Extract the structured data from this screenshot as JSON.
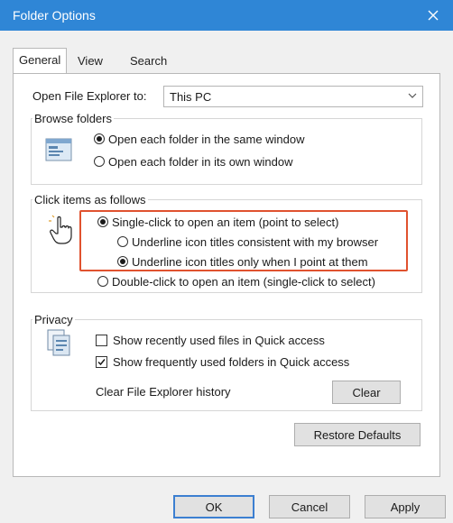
{
  "window": {
    "title": "Folder Options",
    "close_icon": "close-icon"
  },
  "tabs": [
    {
      "label": "General",
      "active": true
    },
    {
      "label": "View",
      "active": false
    },
    {
      "label": "Search",
      "active": false
    }
  ],
  "general": {
    "open_to_label": "Open File Explorer to:",
    "open_to_value": "This PC",
    "browse": {
      "title": "Browse folders",
      "icon": "browse-folders-icon",
      "options": [
        {
          "label": "Open each folder in the same window",
          "checked": true
        },
        {
          "label": "Open each folder in its own window",
          "checked": false
        }
      ]
    },
    "click": {
      "title": "Click items as follows",
      "icon": "hand-pointer-icon",
      "single_click": {
        "label": "Single-click to open an item (point to select)",
        "checked": true
      },
      "underline_always": {
        "label": "Underline icon titles consistent with my browser",
        "checked": false
      },
      "underline_point": {
        "label": "Underline icon titles only when I point at them",
        "checked": true
      },
      "double_click": {
        "label": "Double-click to open an item (single-click to select)",
        "checked": false
      },
      "highlight_color": "#e0522f"
    },
    "privacy": {
      "title": "Privacy",
      "icon": "privacy-icon",
      "recent_files": {
        "label": "Show recently used files in Quick access",
        "checked": false
      },
      "frequent_folders": {
        "label": "Show frequently used folders in Quick access",
        "checked": true
      },
      "clear_label": "Clear File Explorer history",
      "clear_button": "Clear"
    },
    "restore_defaults": "Restore Defaults"
  },
  "footer": {
    "ok": "OK",
    "cancel": "Cancel",
    "apply": "Apply"
  },
  "colors": {
    "titlebar": "#2f86d6",
    "accent": "#3c7fd1"
  }
}
